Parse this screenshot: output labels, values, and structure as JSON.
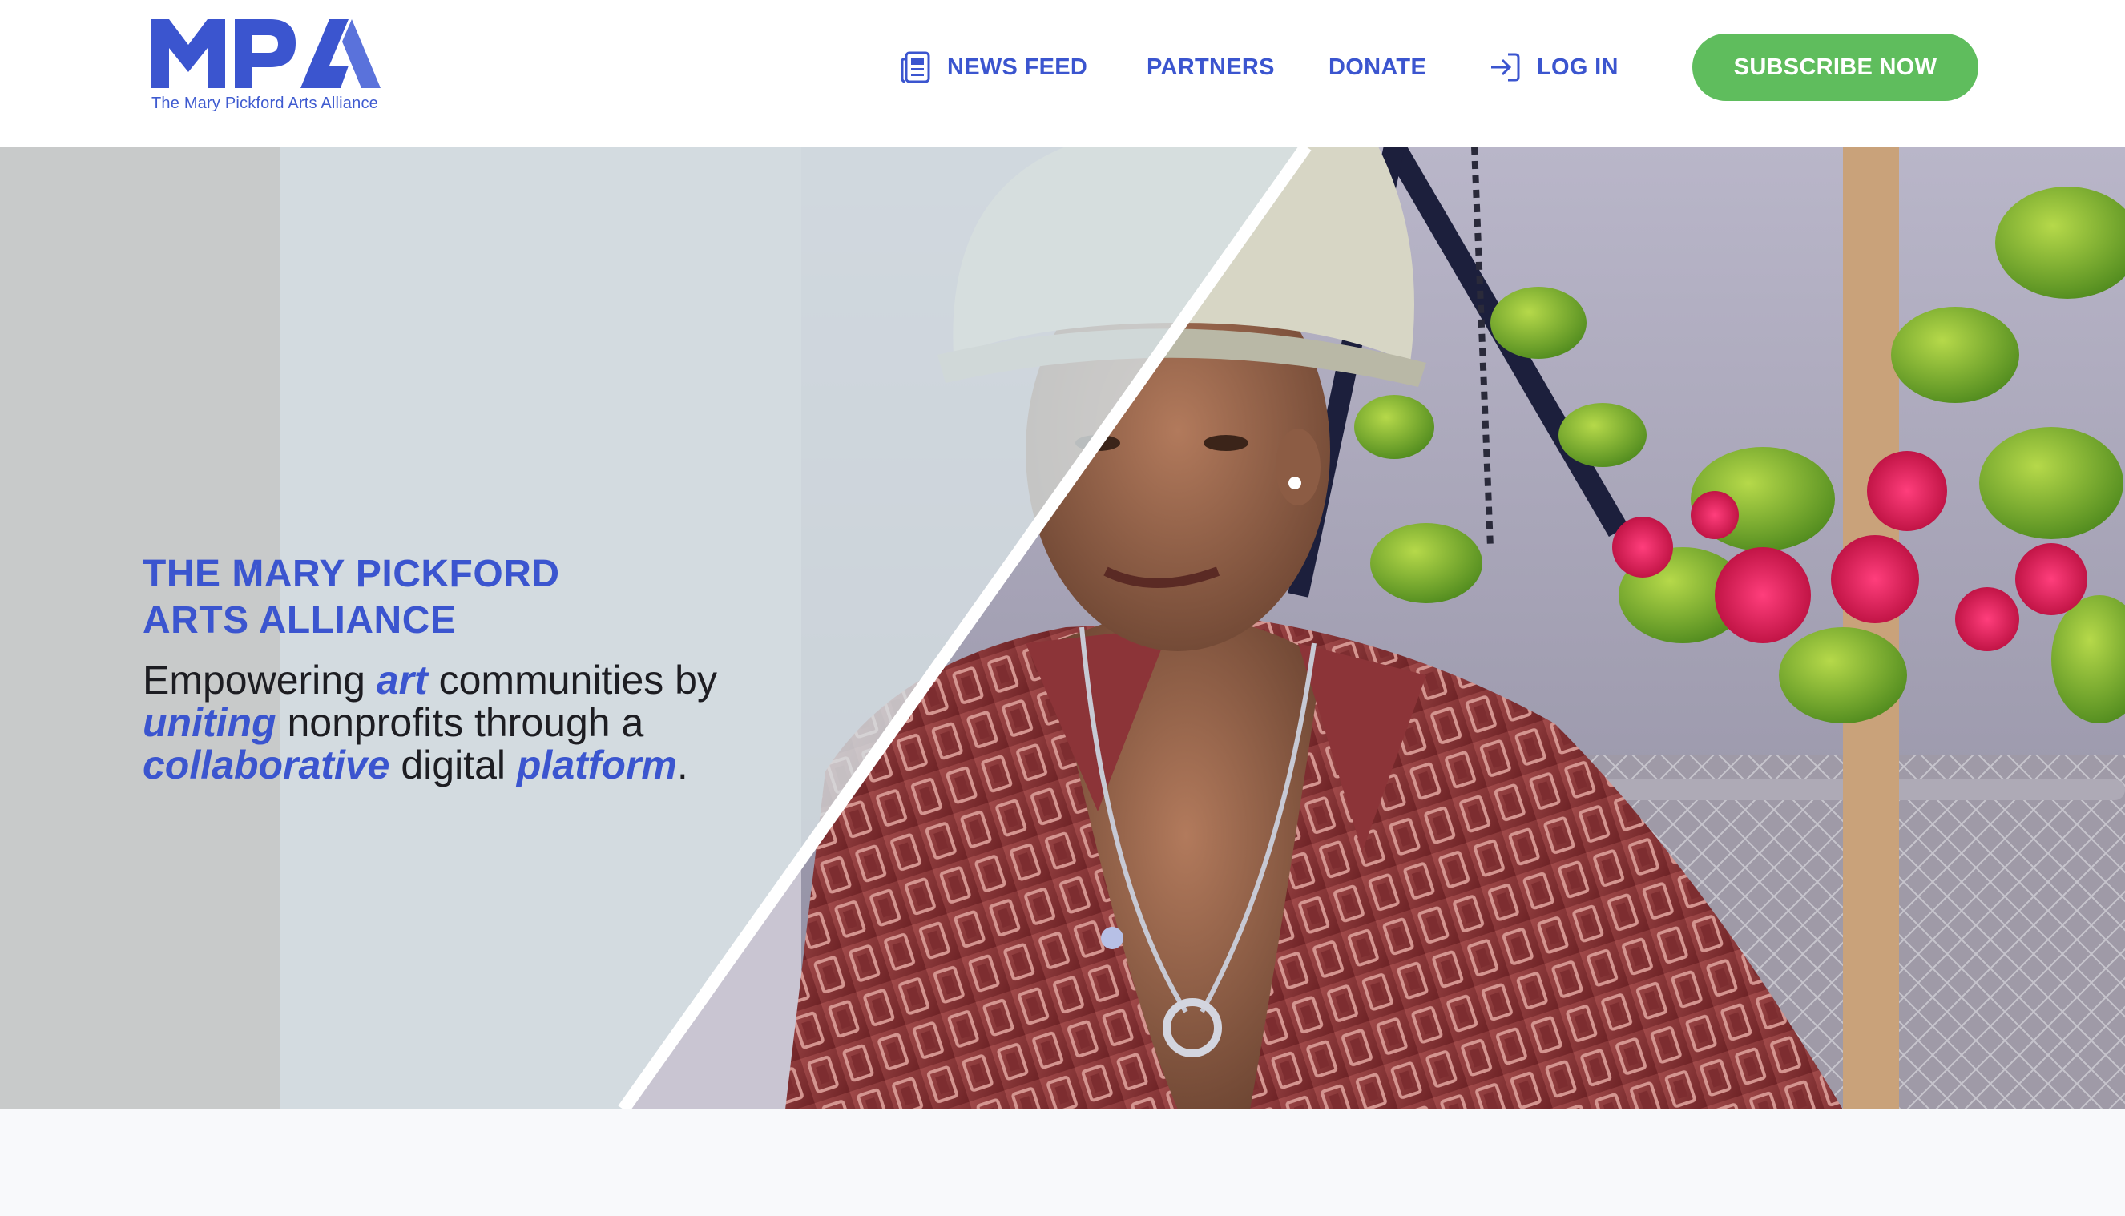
{
  "brand": {
    "logo_text": "MPA",
    "tagline": "The Mary Pickford Arts Alliance"
  },
  "nav": {
    "news_feed": "NEWS FEED",
    "partners": "PARTNERS",
    "donate": "DONATE",
    "log_in": "LOG IN",
    "subscribe": "SUBSCRIBE NOW"
  },
  "hero": {
    "title_line1": "THE MARY PICKFORD",
    "title_line2": "ARTS ALLIANCE",
    "tagline_parts": {
      "p1": "Empowering ",
      "e1": "art",
      "p2": " communities by ",
      "e2": "uniting",
      "p3": " nonprofits through a ",
      "e3": "collaborative",
      "p4": " digital ",
      "e4": "platform",
      "p5": "."
    },
    "photo": "young-man-in-bucket-hat-with-flowers"
  },
  "icons": {
    "news_feed": "newspaper-icon",
    "log_in": "login-arrow-icon"
  },
  "colors": {
    "brand_blue": "#3b55cf",
    "subscribe_green": "#5fbd5d",
    "text_dark": "#1d1d22",
    "page_bg": "#f8f9fb"
  }
}
